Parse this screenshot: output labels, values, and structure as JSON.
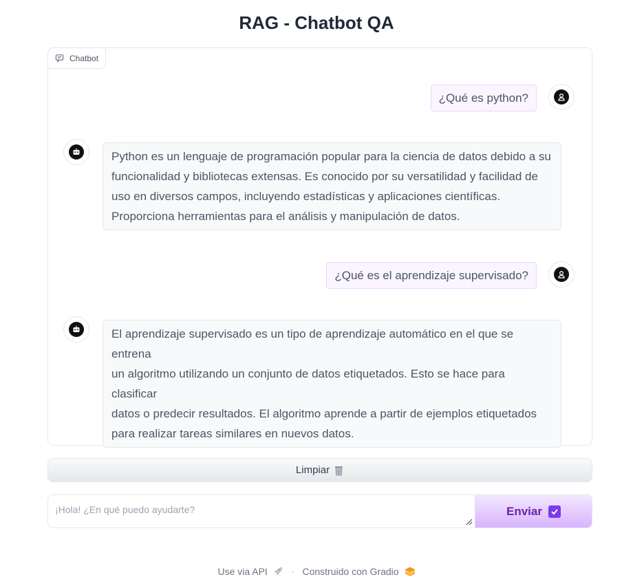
{
  "app": {
    "title": "RAG - Chatbot QA"
  },
  "chatbot": {
    "label": "Chatbot",
    "messages": [
      {
        "role": "user",
        "text": "¿Qué es python?"
      },
      {
        "role": "bot",
        "lines": [
          "Python es un lenguaje de programación popular para la ciencia de datos debido a su",
          "funcionalidad y bibliotecas extensas. Es conocido por su versatilidad y facilidad de",
          "uso en diversos campos, incluyendo estadísticas y aplicaciones científicas.",
          "Proporciona herramientas para el análisis y manipulación de datos."
        ]
      },
      {
        "role": "user",
        "text": "¿Qué es el aprendizaje supervisado?"
      },
      {
        "role": "bot",
        "lines": [
          "El aprendizaje supervisado es un tipo de aprendizaje automático en el que se entrena",
          "un algoritmo utilizando un conjunto de datos etiquetados. Esto se hace para clasificar",
          "datos o predecir resultados. El algoritmo aprende a partir de ejemplos etiquetados",
          "para realizar tareas similares en nuevos datos."
        ]
      }
    ]
  },
  "controls": {
    "clear_label": "Limpiar",
    "clear_icon": "wastebasket-icon",
    "input_placeholder": "¡Hola! ¿En qué puedo ayudarte?",
    "input_value": "",
    "send_label": "Enviar",
    "send_icon": "check-box-icon"
  },
  "footer": {
    "api_label": "Use via API",
    "separator": "·",
    "built_with": "Construido con Gradio"
  },
  "colors": {
    "user_bubble_bg": "#faf5ff",
    "bot_bubble_bg": "#f8f9fb",
    "send_button_accent": "#d8b4fe"
  }
}
